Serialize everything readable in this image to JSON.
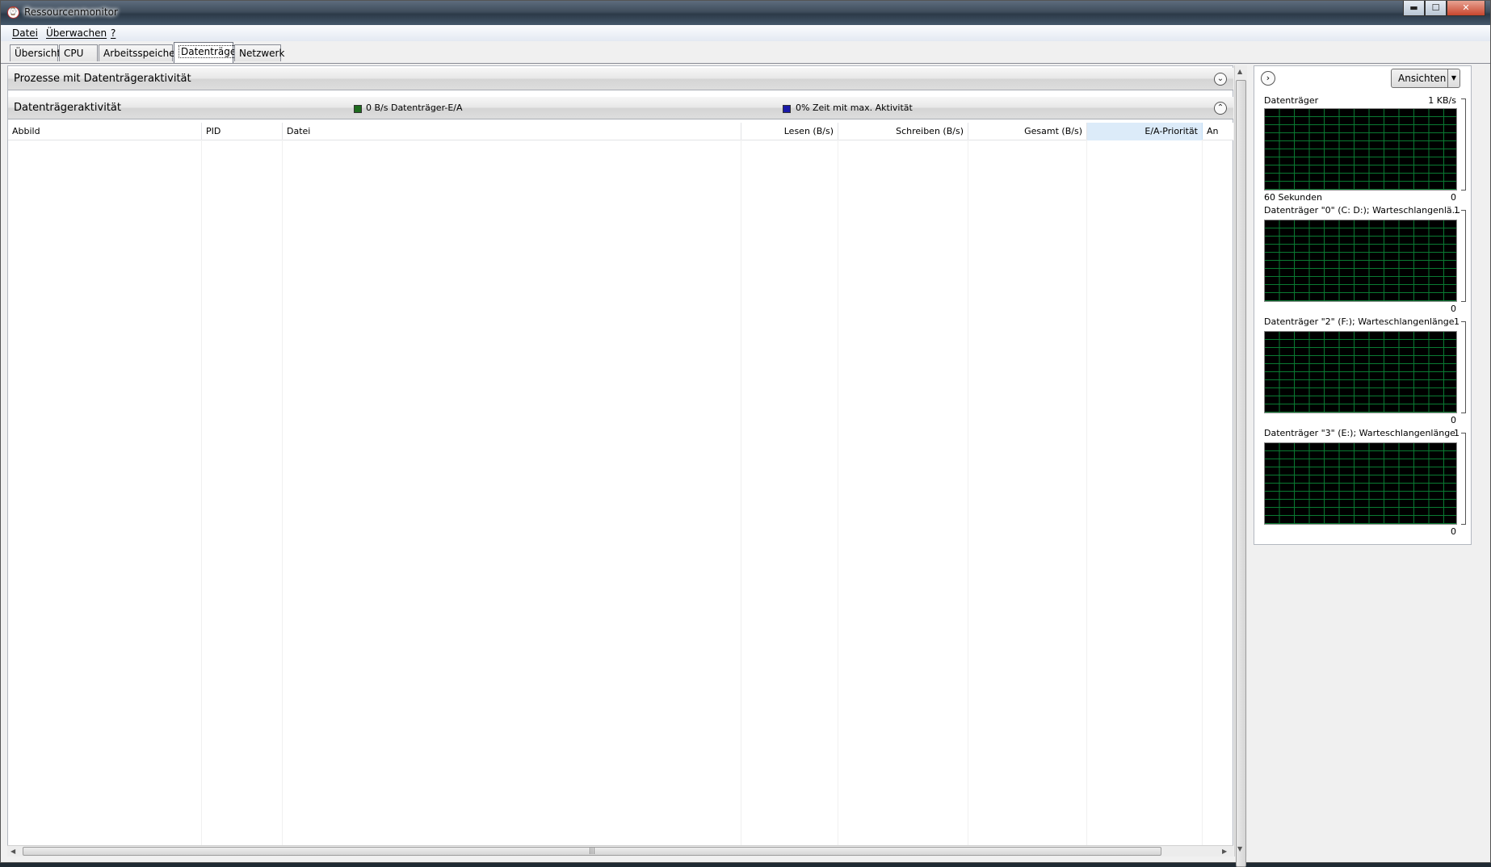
{
  "window": {
    "title": "Ressourcenmonitor",
    "icon": "resource-monitor-icon"
  },
  "window_buttons": {
    "minimize": "▬",
    "maximize": "☐",
    "close": "✕"
  },
  "menu": {
    "file": "Datei",
    "monitor": "Überwachen",
    "help": "?"
  },
  "tabs": [
    {
      "label": "Übersicht"
    },
    {
      "label": "CPU"
    },
    {
      "label": "Arbeitsspeicher"
    },
    {
      "label": "Datenträger",
      "active": true
    },
    {
      "label": "Netzwerk"
    }
  ],
  "sections": {
    "processes": {
      "title": "Prozesse mit Datenträgeraktivität",
      "collapsed": true
    },
    "activity": {
      "title": "Datenträgeraktivität",
      "legend1": {
        "text": "0 B/s Datenträger-E/A",
        "color": "#1e6b1e"
      },
      "legend2": {
        "text": "0% Zeit mit max. Aktivität",
        "color": "#1a1aa8"
      }
    }
  },
  "table": {
    "columns": [
      "Abbild",
      "PID",
      "Datei",
      "Lesen (B/s)",
      "Schreiben (B/s)",
      "Gesamt (B/s)",
      "E/A-Priorität",
      "An"
    ],
    "sorted_column": "E/A-Priorität",
    "rows": []
  },
  "right_panel": {
    "views_label": "Ansichten",
    "graphs": [
      {
        "title": "Datenträger",
        "max": "1 KB/s",
        "min": "0",
        "footer": "60 Sekunden"
      },
      {
        "title": "Datenträger \"0\" (C: D:); Warteschlangenlä...",
        "max": "1",
        "min": "0",
        "footer": ""
      },
      {
        "title": "Datenträger \"2\" (F:); Warteschlangenlänge",
        "max": "1",
        "min": "0",
        "footer": ""
      },
      {
        "title": "Datenträger \"3\" (E:); Warteschlangenlänge",
        "max": "1",
        "min": "0",
        "footer": ""
      }
    ],
    "graph_color": "#0a7a32"
  }
}
